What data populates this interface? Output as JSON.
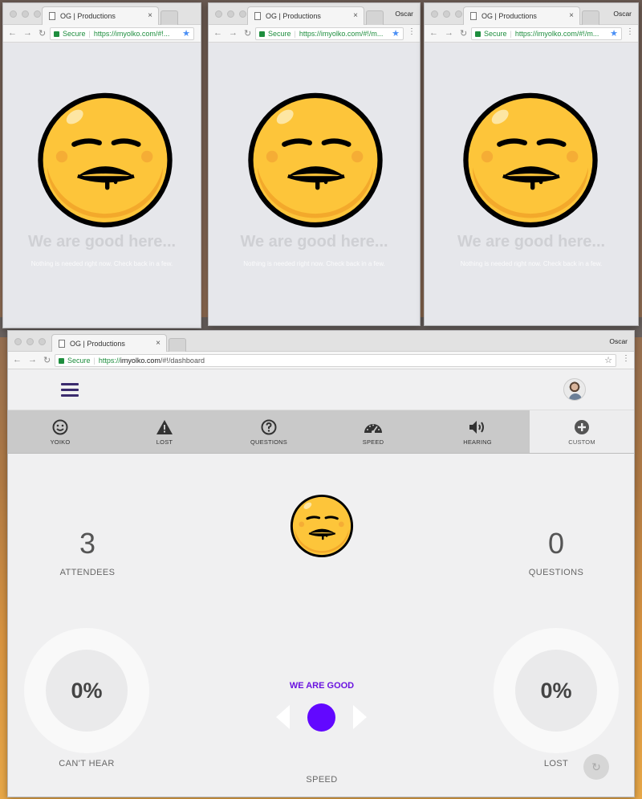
{
  "window": {
    "tab_title": "OG | Productions",
    "user_name": "Oscar",
    "secure_label": "Secure",
    "url_truncated_1": "https://imyolko.com/#!...",
    "url_truncated_2": "https://imyolko.com/#!/m...",
    "url_truncated_3": "https://imyolko.com/#!/m...",
    "url_main_scheme": "https://",
    "url_main_host": "imyolko.com",
    "url_main_path": "/#!/dashboard"
  },
  "attendee_view": {
    "title": "We are good here...",
    "subtitle": "Nothing is needed right now. Check back in a few."
  },
  "dashboard": {
    "icon_tabs": [
      {
        "label": "YOIKO",
        "icon": "smiley-icon"
      },
      {
        "label": "LOST",
        "icon": "warning-icon"
      },
      {
        "label": "QUESTIONS",
        "icon": "question-icon"
      },
      {
        "label": "SPEED",
        "icon": "speedometer-icon"
      },
      {
        "label": "HEARING",
        "icon": "speaker-icon"
      },
      {
        "label": "CUSTOM",
        "icon": "plus-circle-icon"
      }
    ],
    "attendees_count": "3",
    "attendees_label": "ATTENDEES",
    "questions_count": "0",
    "questions_label": "QUESTIONS",
    "cant_hear_percent": "0%",
    "cant_hear_label": "CAN'T HEAR",
    "lost_percent": "0%",
    "lost_label": "LOST",
    "status_text": "WE ARE GOOD",
    "speed_label": "SPEED",
    "colors": {
      "accent": "#6208ff",
      "status_text": "#6a13e0",
      "nav_icon": "#3b2b6e"
    }
  }
}
